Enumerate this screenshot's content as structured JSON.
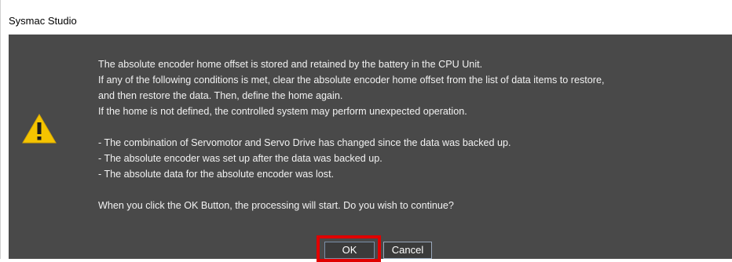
{
  "window": {
    "title": "Sysmac Studio"
  },
  "dialog": {
    "icon": "warning-triangle-icon",
    "lines": [
      "The absolute encoder home offset is stored and retained by the battery in the CPU Unit.",
      "If any of the following conditions is met, clear the absolute encoder home offset from the list of data items to restore,",
      "and then restore the data. Then, define the home again.",
      "If the home is not defined, the controlled system may perform unexpected operation.",
      "",
      "- The combination of Servomotor and Servo Drive has changed since the data was backed up.",
      "- The absolute encoder was set up after the data was backed up.",
      "- The absolute data for the absolute encoder was lost.",
      "",
      "When you click the OK Button, the processing will start. Do you wish to continue?"
    ],
    "ok_label": "OK",
    "cancel_label": "Cancel",
    "colors": {
      "background": "#494949",
      "text": "#f2f2f2",
      "highlight": "#e00000",
      "warning": "#f5c400"
    }
  }
}
